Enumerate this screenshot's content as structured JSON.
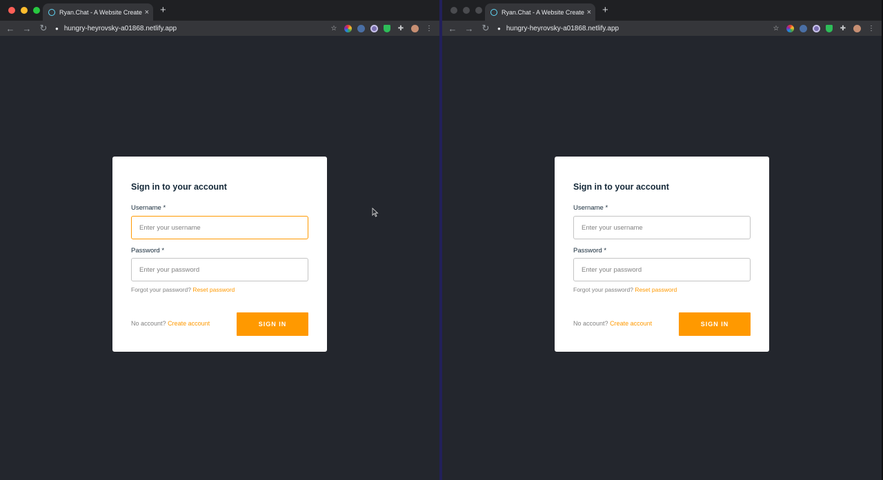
{
  "browser": {
    "tab_title": "Ryan.Chat - A Website Created",
    "tab_close": "×",
    "new_tab": "+",
    "url": "hungry-heyrovsky-a01868.netlify.app",
    "back": "←",
    "forward": "→",
    "reload": "↻",
    "lock": "🔒",
    "star": "☆",
    "menu": "⋮",
    "puzzle": "✚"
  },
  "auth": {
    "title": "Sign in to your account",
    "username_label": "Username",
    "username_placeholder": "Enter your username",
    "password_label": "Password",
    "password_placeholder": "Enter your password",
    "required_mark": "*",
    "forgot_text": "Forgot your password?",
    "reset_link": "Reset password",
    "no_account_text": "No account?",
    "create_link": "Create account",
    "signin_label": "SIGN IN"
  },
  "colors": {
    "accent": "#ff9900",
    "page_bg": "#23262d",
    "card_bg": "#ffffff",
    "text": "#152939"
  },
  "icons": [
    "back-arrow-icon",
    "forward-arrow-icon",
    "reload-icon",
    "lock-icon",
    "star-icon",
    "puzzle-icon",
    "menu-dots-icon",
    "react-favicon-icon",
    "cursor-icon"
  ]
}
